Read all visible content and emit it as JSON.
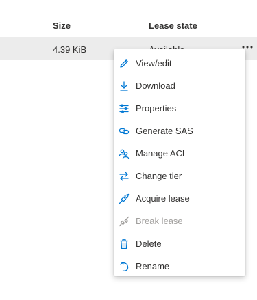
{
  "table": {
    "columns": {
      "size": "Size",
      "lease_state": "Lease state"
    },
    "row": {
      "size": "4.39 KiB",
      "lease_state": "Available"
    },
    "more_label": "..."
  },
  "context_menu": {
    "items": [
      {
        "label": "View/edit",
        "icon": "edit-icon"
      },
      {
        "label": "Download",
        "icon": "download-icon"
      },
      {
        "label": "Properties",
        "icon": "properties-icon"
      },
      {
        "label": "Generate SAS",
        "icon": "link-icon"
      },
      {
        "label": "Manage ACL",
        "icon": "people-icon"
      },
      {
        "label": "Change tier",
        "icon": "swap-arrows-icon"
      },
      {
        "label": "Acquire lease",
        "icon": "plug-icon"
      },
      {
        "label": "Break lease",
        "icon": "broken-plug-icon",
        "disabled": true
      },
      {
        "label": "Delete",
        "icon": "trash-icon"
      },
      {
        "label": "Rename",
        "icon": "rename-icon"
      }
    ]
  },
  "colors": {
    "accent": "#0078d4",
    "row_highlight": "#ececec",
    "disabled_text": "#a19f9d"
  }
}
